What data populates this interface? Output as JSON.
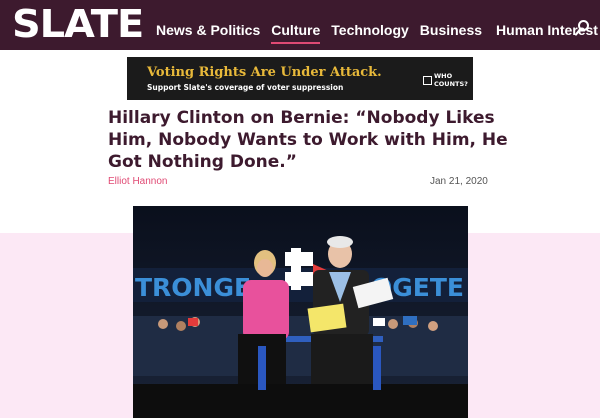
{
  "header": {
    "logo": "SLATE",
    "nav": [
      {
        "label": "News & Politics",
        "active": false
      },
      {
        "label": "Culture",
        "active": true
      },
      {
        "label": "Technology",
        "active": false
      },
      {
        "label": "Business",
        "active": false
      },
      {
        "label": "Human Interest",
        "active": false
      }
    ],
    "search_icon": "search-icon"
  },
  "ad": {
    "title": "Voting Rights Are Under Attack.",
    "subtitle": "Support Slate's coverage of voter suppression",
    "badge": "WHO COUNTS?"
  },
  "article": {
    "headline": "Hillary Clinton on Bernie: “Nobody Likes Him, Nobody Wants to Work with Him, He Got Nothing Done.”",
    "author": "Elliot Hannon",
    "date": "Jan 21, 2020"
  },
  "photo": {
    "banner_left": "TRONGE",
    "banner_right": "OGETE"
  },
  "colors": {
    "brand": "#3d1a2e",
    "accent": "#e04a74",
    "band": "#fce8f5",
    "ad_gold": "#e8b93a"
  }
}
